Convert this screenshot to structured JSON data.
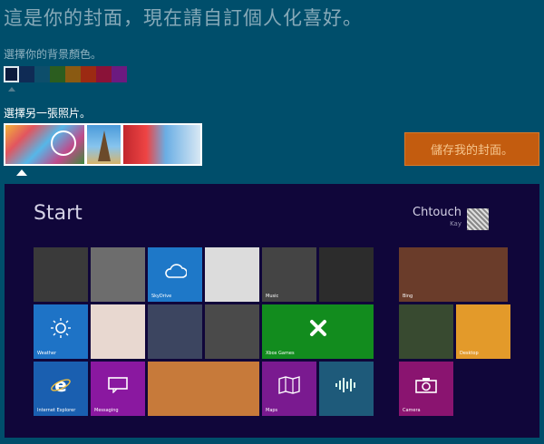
{
  "header": {
    "title": "這是你的封面，現在請自訂個人化喜好。",
    "bg_color_label": "選擇你的背景顏色。",
    "photo_label": "選擇另一張照片。"
  },
  "colors": {
    "page_background": "#004e6b",
    "swatches": [
      "#0c1a3c",
      "#0f2b55",
      "#0d4e6b",
      "#2b5d1f",
      "#8a5a12",
      "#9c2a12",
      "#8a1238",
      "#6c1a80"
    ],
    "selected_swatch": 0,
    "save_button": "#c35c0f",
    "preview_background": "#10063a"
  },
  "photos": [
    "photo-elephant-carnival",
    "photo-paris-eiffel",
    "photo-asia-city"
  ],
  "save_button": {
    "label": "儲存我的封面。"
  },
  "preview": {
    "start_label": "Start",
    "user_name": "Chtouch",
    "user_sub": "Kay",
    "tiles": [
      {
        "label": "",
        "color": "#3a3a3a"
      },
      {
        "label": "",
        "color": "#6d6d6d"
      },
      {
        "label": "SkyDrive",
        "color": "#1e78c8",
        "icon": "cloud-icon"
      },
      {
        "label": "",
        "color": "#dcdcdc"
      },
      {
        "label": "Music",
        "color": "#444444"
      },
      {
        "label": "",
        "color": "#2c2c2c"
      },
      {
        "label": "Bing",
        "color": "#6a3c2a"
      },
      {
        "label": "Weather",
        "color": "#1e73c6",
        "icon": "sun-icon"
      },
      {
        "label": "",
        "color": "#e8d8d0"
      },
      {
        "label": "",
        "color": "#3c4560"
      },
      {
        "label": "",
        "color": "#4a4a4a"
      },
      {
        "label": "Xbox Games",
        "color": "#128c1e",
        "icon": "xbox-icon"
      },
      {
        "label": "",
        "color": "#384a30"
      },
      {
        "label": "Desktop",
        "color": "#e39a2a"
      },
      {
        "label": "Internet Explorer",
        "color": "#1a5fb0",
        "icon": "ie-icon"
      },
      {
        "label": "Messaging",
        "color": "#8a18a0",
        "icon": "messaging-icon"
      },
      {
        "label": "",
        "color": "#c77a3a"
      },
      {
        "label": "Maps",
        "color": "#7a1a90",
        "icon": "maps-icon"
      },
      {
        "label": "",
        "color": "#1e5a7a",
        "icon": "sound-icon"
      },
      {
        "label": "Camera",
        "color": "#8a1470",
        "icon": "camera-icon"
      }
    ]
  }
}
